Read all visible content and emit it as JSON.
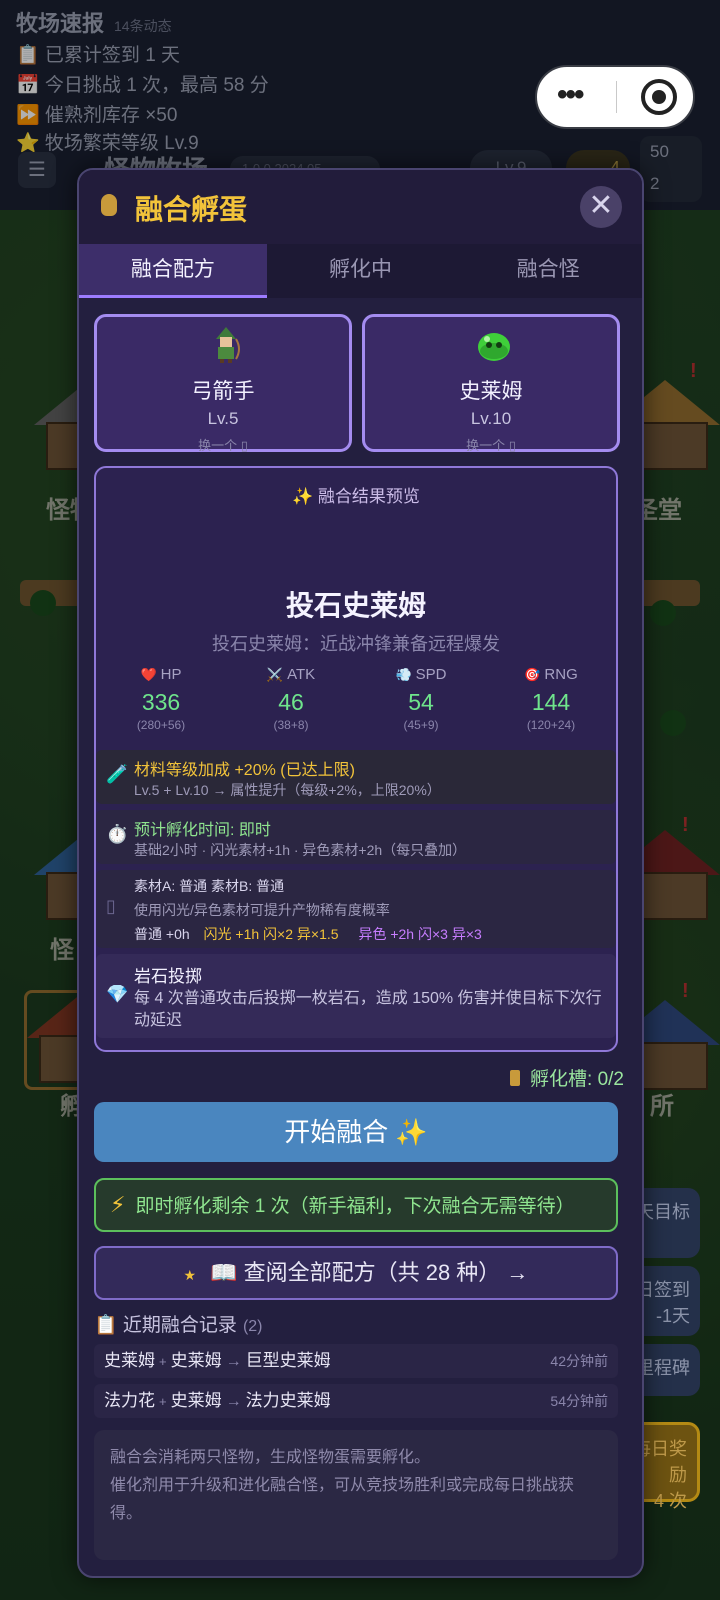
{
  "news": {
    "title": "牧场速报",
    "count": "14条动态",
    "lines": [
      "📋 已累计签到 1 天",
      "📅 今日挑战 1 次，最高 58 分",
      "⏩ 催熟剂库存 ×50",
      "⭐ 牧场繁荣等级 Lv.9"
    ]
  },
  "header": {
    "menu_icon": "☰",
    "ranch_title": "怪物牧场",
    "version": "1.0.0 2024.05",
    "level": "Lv.9",
    "coins": "4",
    "resource_a": "50",
    "resource_b": "2"
  },
  "capsule": {
    "more_icon": "more-dots",
    "close_icon": "target"
  },
  "world": {
    "labels": [
      "怪物",
      "圣堂",
      "怪",
      "孵化",
      "所"
    ],
    "side_buttons": [
      "天目标",
      "日签到",
      "-1天",
      "里程碑",
      "每日奖励",
      "4 次"
    ]
  },
  "modal": {
    "title": "融合孵蛋",
    "close": "✕",
    "tabs": [
      "融合配方",
      "孵化中",
      "融合怪"
    ],
    "slot_a": {
      "name": "弓箭手",
      "level": "Lv.5",
      "swap": "换一个 ▯"
    },
    "slot_b": {
      "name": "史莱姆",
      "level": "Lv.10",
      "swap": "换一个 ▯"
    },
    "preview": {
      "title": "✨ 融合结果预览",
      "name": "投石史莱姆",
      "desc": "投石史莱姆：近战冲锋兼备远程爆发",
      "stats": [
        {
          "icon": "❤️",
          "label": "HP",
          "value": "336",
          "calc": "(280+56)"
        },
        {
          "icon": "⚔️",
          "label": "ATK",
          "value": "46",
          "calc": "(38+8)"
        },
        {
          "icon": "💨",
          "label": "SPD",
          "value": "54",
          "calc": "(45+9)"
        },
        {
          "icon": "🎯",
          "label": "RNG",
          "value": "144",
          "calc": "(120+24)"
        }
      ],
      "bonus": {
        "icon": "🧪",
        "main": "材料等级加成 +20% (已达上限)",
        "sub": "Lv.5 + Lv.10 → 属性提升（每级+2%，上限20%）"
      },
      "time": {
        "icon": "⏱️",
        "main": "预计孵化时间: 即时",
        "sub": "基础2小时 · 闪光素材+1h · 异色素材+2h（每只叠加）"
      },
      "material": {
        "icon": "▯",
        "line1": "素材A: 普通  素材B: 普通",
        "line2": "使用闪光/异色素材可提升产物稀有度概率",
        "normal": "普通 +0h",
        "shiny": "闪光 +1h 闪×2 异×1.5",
        "variant": "异色 +2h 闪×3 异×3"
      },
      "skill": {
        "icon": "💎",
        "name": "岩石投掷",
        "desc": "每 4 次普通攻击后投掷一枚岩石，造成 150% 伤害并使目标下次行动延迟"
      }
    },
    "incubator": "孵化槽: 0/2",
    "start_button": "开始融合 ✨",
    "instant": "即时孵化剩余 1 次（新手福利，下次融合无需等待）",
    "recipes_button": "📖 查阅全部配方（共 28 种） →",
    "history": {
      "title": "📋 近期融合记录",
      "count": "(2)",
      "rows": [
        {
          "a": "史莱姆",
          "b": "史莱姆",
          "result": "巨型史莱姆",
          "time": "42分钟前"
        },
        {
          "a": "法力花",
          "b": "史莱姆",
          "result": "法力史莱姆",
          "time": "54分钟前"
        }
      ]
    },
    "notes": [
      "融合会消耗两只怪物，生成怪物蛋需要孵化。",
      "催化剂用于升级和进化融合怪，可从竞技场胜利或完成每日挑战获得。"
    ]
  }
}
